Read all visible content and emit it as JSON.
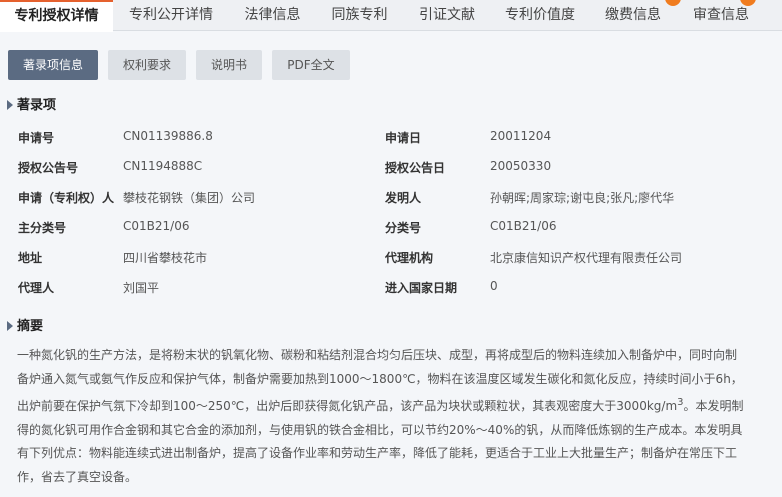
{
  "tabs": [
    {
      "label": "专利授权详情"
    },
    {
      "label": "专利公开详情"
    },
    {
      "label": "法律信息"
    },
    {
      "label": "同族专利"
    },
    {
      "label": "引证文献"
    },
    {
      "label": "专利价值度"
    },
    {
      "label": "缴费信息"
    },
    {
      "label": "审查信息"
    }
  ],
  "subtabs": [
    {
      "label": "著录项信息"
    },
    {
      "label": "权利要求"
    },
    {
      "label": "说明书"
    },
    {
      "label": "PDF全文"
    }
  ],
  "biblio": {
    "title": "著录项",
    "rows": [
      {
        "l1": "申请号",
        "v1": "CN01139886.8",
        "l2": "申请日",
        "v2": "20011204"
      },
      {
        "l1": "授权公告号",
        "v1": "CN1194888C",
        "l2": "授权公告日",
        "v2": "20050330"
      },
      {
        "l1": "申请（专利权）人",
        "v1": "攀枝花钢铁（集团）公司",
        "l2": "发明人",
        "v2": "孙朝晖;周家琮;谢屯良;张凡;廖代华"
      },
      {
        "l1": "主分类号",
        "v1": "C01B21/06",
        "l2": "分类号",
        "v2": "C01B21/06"
      },
      {
        "l1": "地址",
        "v1": "四川省攀枝花市",
        "l2": "代理机构",
        "v2": "北京康信知识产权代理有限责任公司"
      },
      {
        "l1": "代理人",
        "v1": "刘国平",
        "l2": "进入国家日期",
        "v2": "0"
      }
    ]
  },
  "abstract": {
    "title": "摘要",
    "text_before": "一种氮化钒的生产方法，是将粉末状的钒氧化物、碳粉和粘结剂混合均匀后压块、成型，再将成型后的物料连续加入制备炉中，同时向制备炉通入氮气或氨气作反应和保护气体，制备炉需要加热到1000～1800℃，物料在该温度区域发生碳化和氮化反应，持续时间小于6h，出炉前要在保护气氛下冷却到100～250℃，出炉后即获得氮化钒产品，该产品为块状或颗粒状，其表观密度大于3000kg/m",
    "sup": "3",
    "text_after": "。本发明制得的氮化钒可用作合金钢和其它合金的添加剂，与使用钒的铁合金相比，可以节约20%～40%的钒，从而降低炼钢的生产成本。本发明具有下列优点：物料能连续式进出制备炉，提高了设备作业率和劳动生产率，降低了能耗，更适合于工业上大批量生产；制备炉在常压下工作，省去了真空设备。"
  },
  "colors": {
    "accent": "#e5612e",
    "primary_button": "#5b6b82",
    "badge": "#f07c1e"
  }
}
